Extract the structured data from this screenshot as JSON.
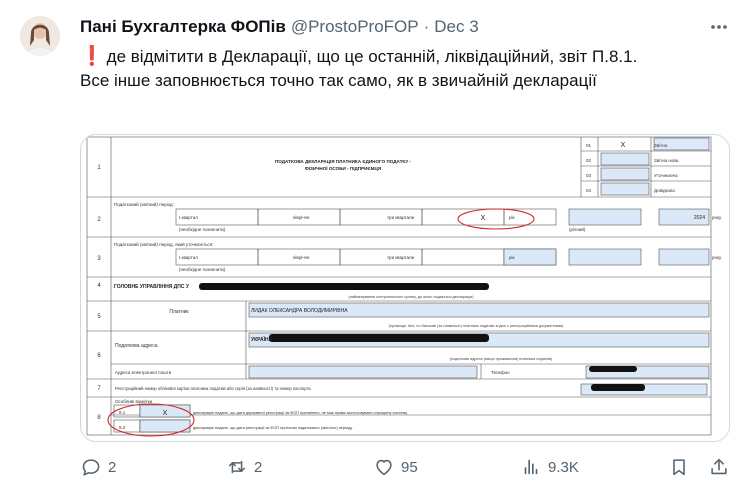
{
  "author": {
    "name": "Пані Бухгалтерка ФОПів",
    "handle": "@ProstoProFOP",
    "separator": "·",
    "date": "Dec 3"
  },
  "tweet": {
    "emoji": "❗",
    "line1": "де відмітити в Декларації, що це останній, ліквідаційний, звіт П.8.1.",
    "line2": "Все інше заповнюється точно так само, як в звичайній декларації"
  },
  "document": {
    "title_line1": "ПОДАТКОВА ДЕКЛАРАЦІЯ ПЛАТНИКА ЄДИНОГО ПОДАТКУ -",
    "title_line2": "ФІЗИЧНОЇ ОСОБИ - ПІДПРИЄМЦЯ",
    "form_types": [
      {
        "code": "01",
        "mark": "X",
        "label": "Звітна"
      },
      {
        "code": "02",
        "mark": "",
        "label": "Звітна нова"
      },
      {
        "code": "03",
        "mark": "",
        "label": "Уточнююча"
      },
      {
        "code": "04",
        "mark": "",
        "label": "Довідково"
      }
    ],
    "row_numbers": [
      "1",
      "2",
      "3",
      "4",
      "5",
      "6",
      "7",
      "8"
    ],
    "row2": {
      "label": "Податковий (звітний) період:",
      "cells": [
        "I квартал",
        "півріччя",
        "три квартали",
        "рік"
      ],
      "mark": "X",
      "year": "2024",
      "year_suffix": "року",
      "sub_left": "(необхідне позначити)",
      "sub_right": "(річний)"
    },
    "row3": {
      "label": "Податковий (звітний) період, який уточнюється:",
      "cells": [
        "I квартал",
        "півріччя",
        "три квартали",
        "рік"
      ],
      "year_suffix": "року",
      "sub_left": "(необхідне позначити)"
    },
    "row4": {
      "label": "ГОЛОВНЕ УПРАВЛІННЯ ДПС У",
      "sub": "(найменування контролюючого органу, до якого подається декларація)"
    },
    "row5": {
      "label": "Платник",
      "value": "ЛИДАК ОЛЕКСАНДРА ВОЛОДИМИРІВНА",
      "sub": "(прізвище, ім'я, по батькові (за наявності) платника податків згідно з реєстраційними документами)"
    },
    "row6": {
      "label": "Податкова адреса",
      "country": "УКРАЇНА",
      "sub": "(податкова адреса (місце проживання) платника податків)",
      "email_label": "Адреса електронної пошти",
      "phone_label": "Телефон"
    },
    "row7": {
      "label": "Реєстраційний номер облікової картки платника податків або серія (за наявності) та номер паспорта"
    },
    "row8": {
      "label": "Особливі відмітки",
      "items": [
        {
          "code": "8.1",
          "mark": "X",
          "text": "декларацію подано, що дата державної реєстрації як ФОП припинено, не має права застосовувати спрощену систему"
        },
        {
          "code": "8.2",
          "mark": "",
          "text": "декларацію подано, що дата реєстрації як ФОП протягом податкового (звітного) періоду"
        }
      ]
    }
  },
  "actions": {
    "reply": "2",
    "repost": "2",
    "like": "95",
    "views": "9.3K"
  }
}
